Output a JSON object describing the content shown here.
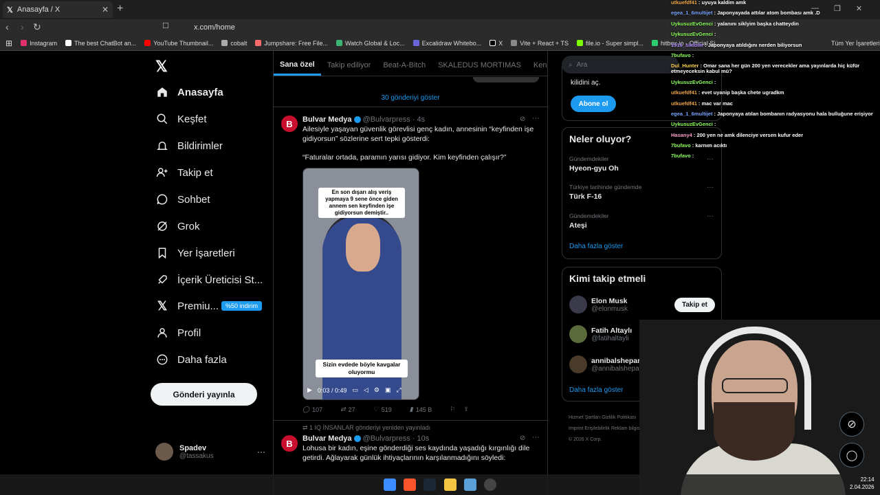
{
  "browser": {
    "tab_title": "Anasayfa / X",
    "url": "x.com/home",
    "bookmarks": [
      "Instagram",
      "The best ChatBot an...",
      "YouTube Thumbnail...",
      "cobalt",
      "Jumpshare: Free File...",
      "Watch Global & Loc...",
      "Excalidraw Whitebo...",
      "X",
      "Vite + React + TS",
      "file.io - Super simpl...",
      "hitbox.io - Official Si...",
      "Tüm Yer İşaretleri"
    ]
  },
  "nav": {
    "items": [
      "Anasayfa",
      "Keşfet",
      "Bildirimler",
      "Takip et",
      "Sohbet",
      "Grok",
      "Yer İşaretleri",
      "İçerik Üreticisi St...",
      "Premiu...",
      "Profil",
      "Daha fazla"
    ],
    "premium_badge": "%50 indirim",
    "post_button": "Gönderi yayınla",
    "profile_name": "Spadev",
    "profile_handle": "@tassakus"
  },
  "timeline": {
    "tabs": [
      "Sana özel",
      "Takip ediliyor",
      "Beat-A-Bitch",
      "SKALEDUS MORTIMAS",
      "Kend"
    ],
    "show_posts": "30 gönderiyi göster",
    "tweet1": {
      "name": "Bulvar Medya",
      "handle": "@Bulvarpress · 4s",
      "text1": "Ailesiyle yaşayan güvenlik görevlisi genç kadın, annesinin “keyfinden işe gidiyorsun” sözlerine sert tepki gösterdi:",
      "text2": "“Faturalar ortada, paramın yarısı gidiyor. Kim keyfinden çalışır?”",
      "video_caption_top": "En son dışarı alış veriş yapmaya 9 sene önce giden annem sen keyfinden işe gidiyorsun demiştir..",
      "video_caption_bottom": "Sizin evdede böyle kavgalar oluyormu",
      "video_time": "0:03 / 0:49",
      "replies": "107",
      "reposts": "27",
      "likes": "519",
      "views": "145 B"
    },
    "repost_line": "1 IQ İNSANLAR gönderiyi yeniden yayınladı",
    "tweet2": {
      "name": "Bulvar Medya",
      "handle": "@Bulvarpress · 10s",
      "text": "Lohusa bir kadın, eşine gönderdiği ses kaydında yaşadığı kırgınlığı dile getirdi. Ağlayarak günlük ihtiyaçlarının karşılanmadığını söyledi:"
    }
  },
  "sidebar": {
    "search_placeholder": "Ara",
    "unlock_text": "kilidini aç.",
    "subscribe": "Abone ol",
    "trends_title": "Neler oluyor?",
    "trends": [
      {
        "context": "Gündemdekiler",
        "topic": "Hyeon-gyu Oh"
      },
      {
        "context": "Türkiye tarihinde gündemde",
        "topic": "Türk F-16"
      },
      {
        "context": "Gündemdekiler",
        "topic": "Ateşi"
      }
    ],
    "show_more": "Daha fazla göster",
    "who_title": "Kimi takip etmeli",
    "who": [
      {
        "name": "Elon Musk",
        "handle": "@elonmusk"
      },
      {
        "name": "Fatih Altaylı",
        "handle": "@fatihaltayli"
      },
      {
        "name": "annibalsheparrd",
        "handle": "@annibalsheparrd"
      }
    ],
    "follow_label": "Takip et",
    "footer1": "Hizmet Şartları   Gizlilik Politikası",
    "footer2": "Imprint   Erişilebilirlik   Reklam bilgisi",
    "footer3": "© 2026 X Corp."
  },
  "chat": [
    {
      "user": "utkuefdf41",
      "color": "#f2a94b",
      "msg": "uyuya kaldim amk"
    },
    {
      "user": "egea_1_6multijet",
      "color": "#7aa4ff",
      "msg": "Japonyayada attılar atom bombası amk .D"
    },
    {
      "user": "UykusuzEvGenci",
      "color": "#8cff5a",
      "msg": "yalanını siklyim başka chatteydin"
    },
    {
      "user": "UykusuzEvGenci",
      "color": "#8cff5a",
      "msg": ""
    },
    {
      "user": "1916_siklbilir",
      "color": "#b48cff",
      "msg": "Japonyaya atıldığını nerden biliyorsun"
    },
    {
      "user": "7bufavo",
      "color": "#8cff5a",
      "msg": ""
    },
    {
      "user": "Dul_Hunter",
      "color": "#ffd34d",
      "msg": "Omar sana her gün 200 yen verecekler ama yayınlarda hiç küfür etmeyeceksin kabul mü?"
    },
    {
      "user": "UykusuzEvGenci",
      "color": "#8cff5a",
      "msg": ""
    },
    {
      "user": "utkuefdf41",
      "color": "#f2a94b",
      "msg": "evet uyanip başka chete ugradkm"
    },
    {
      "user": "utkuefdf41",
      "color": "#f2a94b",
      "msg": "mac var mac"
    },
    {
      "user": "egea_1_6multijet",
      "color": "#7aa4ff",
      "msg": "Japonyaya atılan bombanın radyasyonu hala bulluğune erişiyor"
    },
    {
      "user": "UykusuzEvGenci",
      "color": "#8cff5a",
      "msg": ""
    },
    {
      "user": "Hasany4",
      "color": "#ff9ecb",
      "msg": "200 yen ne amk dilenciye versen kufur eder"
    },
    {
      "user": "7bufavo",
      "color": "#8cff5a",
      "msg": "karnım acıktı"
    },
    {
      "user": "7bufavo",
      "color": "#8cff5a",
      "msg": ""
    }
  ],
  "clock": {
    "time": "22:14",
    "date": "2.04.2026"
  }
}
